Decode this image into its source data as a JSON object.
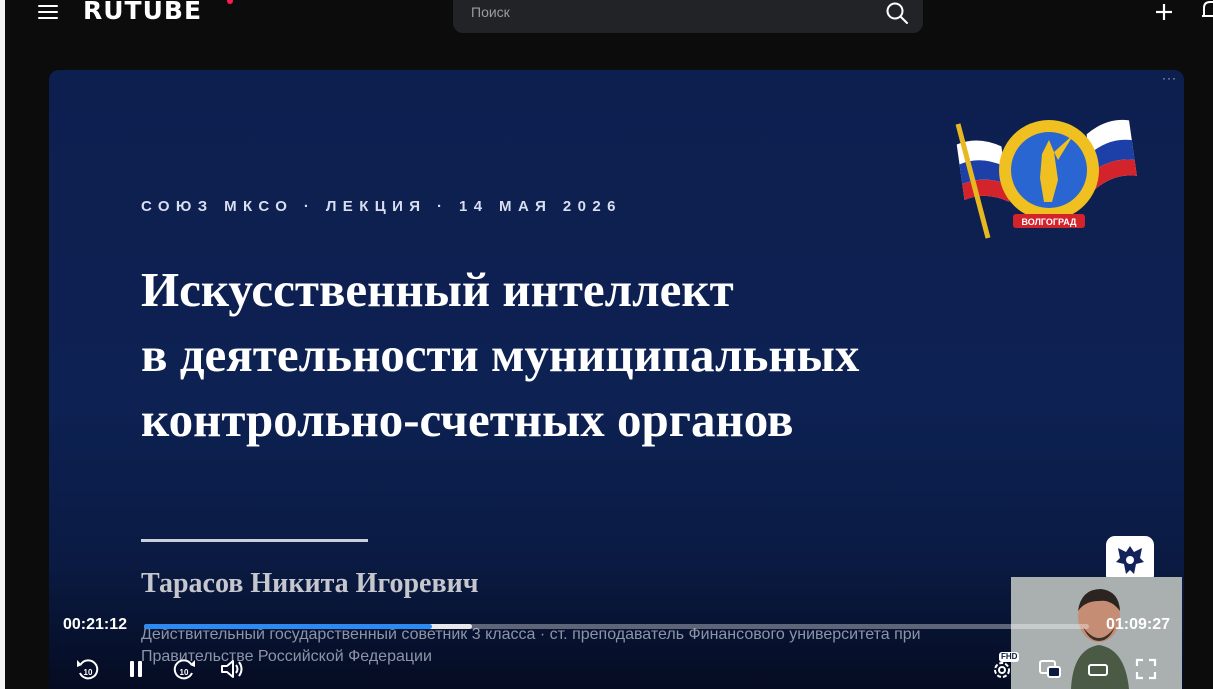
{
  "header": {
    "logo_text": "RUTUBE",
    "search_placeholder": "Поиск"
  },
  "slide": {
    "kicker": "СОЮЗ МКСО · ЛЕКЦИЯ · 14 МАЯ 2026",
    "title_lines": [
      "Искусственный интеллект",
      "в деятельности муниципальных",
      "контрольно-счетных органов"
    ],
    "speaker_name": "Тарасов Никита Игоревич",
    "speaker_role": "Действительный государственный советник 3 класса · ст. преподаватель Финансового университета при Правительстве Российской Федерации",
    "emblem_text": "ВОЛГОГРАД"
  },
  "player": {
    "time_current": "00:21:12",
    "time_total": "01:09:27",
    "progress_fraction": 0.305,
    "buffered_fraction": 0.347,
    "quality_badge": "FHD",
    "rewind_seconds": "10",
    "forward_seconds": "10"
  },
  "colors": {
    "brand_accent": "#ff1b50",
    "progress": "#2c8af2",
    "slide_background": "#0d1f4f"
  }
}
